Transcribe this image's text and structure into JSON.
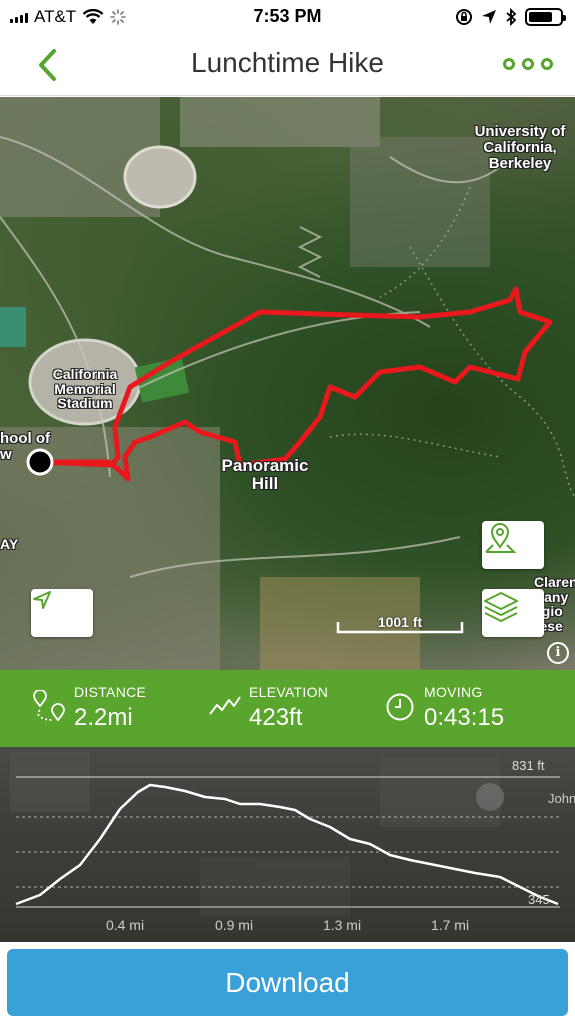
{
  "status_bar": {
    "carrier": "AT&T",
    "time": "7:53 PM",
    "battery_level": 0.75
  },
  "header": {
    "title": "Lunchtime Hike",
    "back_icon": "chevron-left-icon",
    "more_icon": "more-dots-icon"
  },
  "colors": {
    "accent_green": "#5aa52d",
    "route_red": "#e8181c",
    "download_blue": "#3aa1d8"
  },
  "map": {
    "labels": {
      "university": "University of California, Berkeley",
      "stadium": "California Memorial Stadium",
      "hill": "Panoramic Hill",
      "school": "hool of\nw",
      "ay": "AY",
      "claremont": "Claren\nCany\negio\nrese"
    },
    "scale_label": "1001 ft",
    "info_label": "i"
  },
  "stats": {
    "distance": {
      "label": "DISTANCE",
      "value": "2.2mi"
    },
    "elevation": {
      "label": "ELEVATION",
      "value": "423ft"
    },
    "moving": {
      "label": "MOVING",
      "value": "0:43:15"
    }
  },
  "elevation_chart": {
    "y_top_label": "831 ft",
    "y_bottom_label": "345",
    "x_ticks": [
      "0.4 mi",
      "0.9 mi",
      "1.3 mi",
      "1.7 mi"
    ],
    "background_label": "John"
  },
  "download": {
    "label": "Download"
  }
}
